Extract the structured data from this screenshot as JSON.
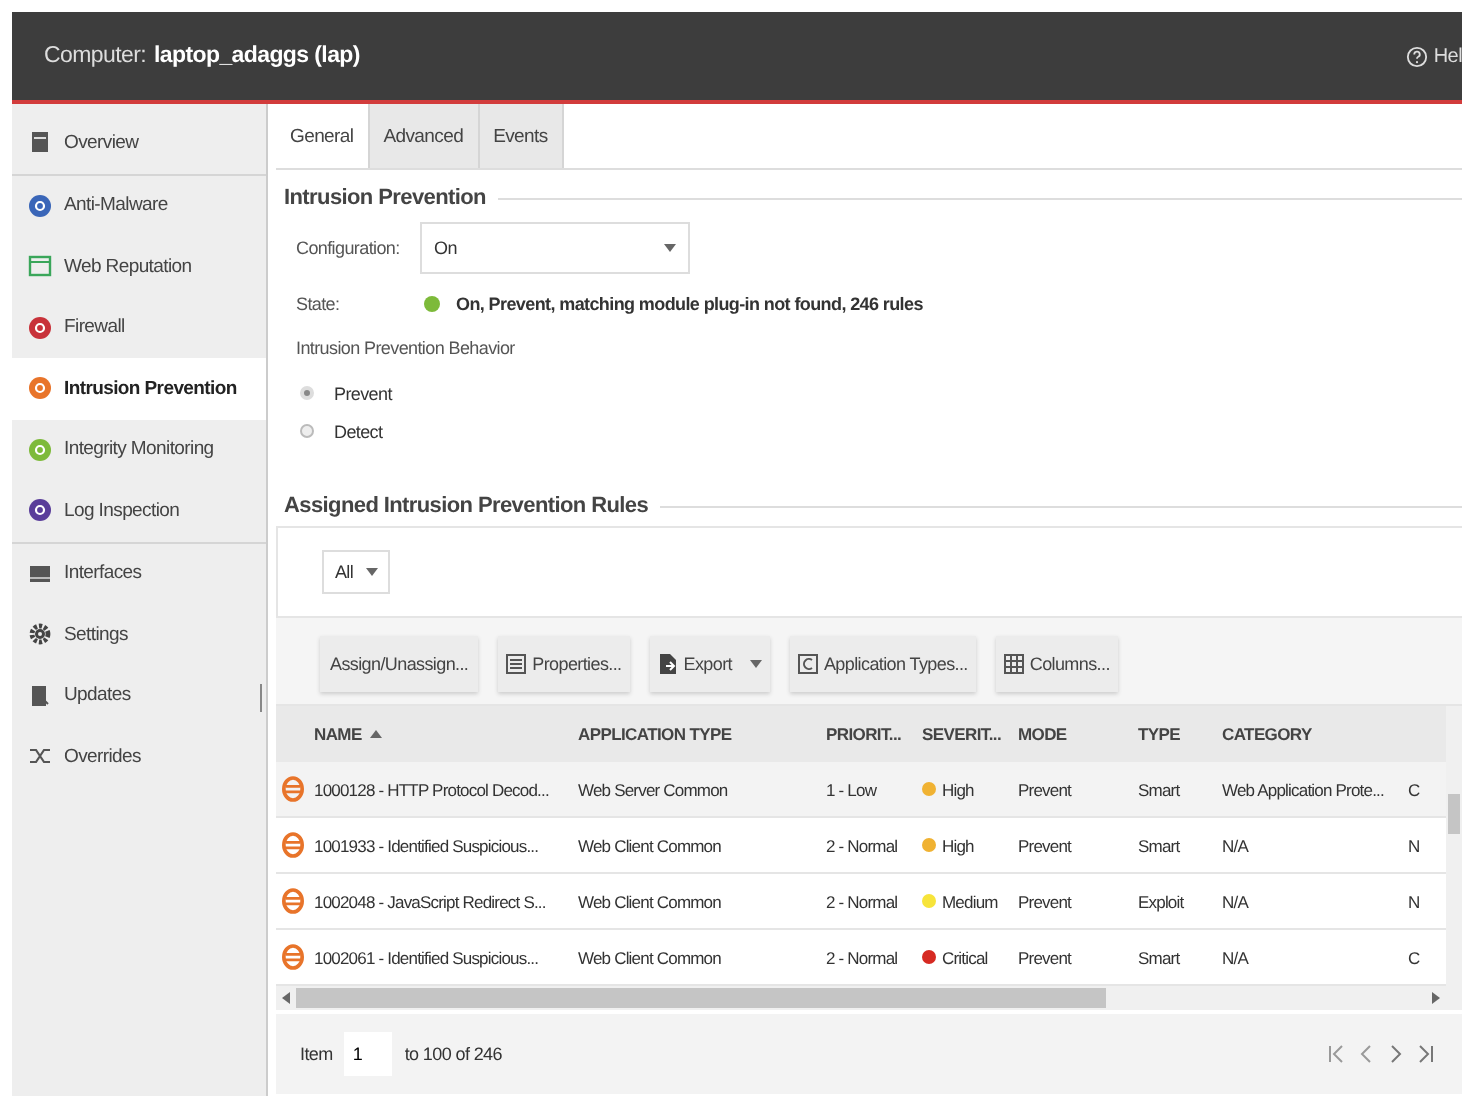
{
  "header": {
    "label": "Computer:",
    "computer": "laptop_adaggs (lap)",
    "help": "Hel"
  },
  "sidebar": {
    "groups": [
      [
        {
          "label": "Overview",
          "kind": "overview",
          "selected": false
        }
      ],
      [
        {
          "label": "Anti-Malware",
          "kind": "anti-malware",
          "selected": false
        },
        {
          "label": "Web Reputation",
          "kind": "web-reputation",
          "selected": false
        },
        {
          "label": "Firewall",
          "kind": "firewall",
          "selected": false
        },
        {
          "label": "Intrusion Prevention",
          "kind": "intrusion",
          "selected": true
        },
        {
          "label": "Integrity Monitoring",
          "kind": "integrity",
          "selected": false
        },
        {
          "label": "Log Inspection",
          "kind": "log",
          "selected": false
        }
      ],
      [
        {
          "label": "Interfaces",
          "kind": "interfaces",
          "selected": false
        },
        {
          "label": "Settings",
          "kind": "settings",
          "selected": false
        },
        {
          "label": "Updates",
          "kind": "updates",
          "selected": false
        },
        {
          "label": "Overrides",
          "kind": "overrides",
          "selected": false
        }
      ]
    ]
  },
  "tabs": [
    {
      "label": "General",
      "selected": true
    },
    {
      "label": "Advanced",
      "selected": false
    },
    {
      "label": "Events",
      "selected": false
    }
  ],
  "intrusion_prevention": {
    "title": "Intrusion Prevention",
    "configuration_label": "Configuration:",
    "configuration_value": "On",
    "state_label": "State:",
    "state": {
      "color": "#7dba3a"
    },
    "state_text": "On, Prevent, matching module plug-in not found, 246 rules",
    "behavior_label": "Intrusion Prevention Behavior",
    "behaviors": [
      {
        "label": "Prevent",
        "selected": true
      },
      {
        "label": "Detect",
        "selected": false
      }
    ]
  },
  "rules": {
    "title": "Assigned Intrusion Prevention Rules",
    "filter": "All",
    "toolbar": [
      {
        "label": "Assign/Unassign...",
        "kind": "plain"
      },
      {
        "label": "Properties...",
        "kind": "properties"
      },
      {
        "label": "Export",
        "kind": "export"
      },
      {
        "label": "Application Types...",
        "kind": "apptypes"
      },
      {
        "label": "Columns...",
        "kind": "columns"
      }
    ],
    "columns": [
      {
        "label": "NAME",
        "sorted": true
      },
      {
        "label": "APPLICATION TYPE",
        "sorted": false
      },
      {
        "label": "PRIORIT...",
        "sorted": false
      },
      {
        "label": "SEVERIT...",
        "sorted": false
      },
      {
        "label": "MODE",
        "sorted": false
      },
      {
        "label": "TYPE",
        "sorted": false
      },
      {
        "label": "CATEGORY",
        "sorted": false
      }
    ],
    "rows": [
      {
        "name": "1000128 - HTTP Protocol Decod...",
        "application_type": "Web Server Common",
        "priority": "1 - Low",
        "severity": "High",
        "color": "#f0b232",
        "mode": "Prevent",
        "type": "Smart",
        "category": "Web Application Prote...",
        "column_8": "C"
      },
      {
        "name": "1001933 - Identified Suspicious...",
        "application_type": "Web Client Common",
        "priority": "2 - Normal",
        "severity": "High",
        "color": "#f0b232",
        "mode": "Prevent",
        "type": "Smart",
        "category": "N/A",
        "column_8": "N"
      },
      {
        "name": "1002048 - JavaScript Redirect S...",
        "application_type": "Web Client Common",
        "priority": "2 - Normal",
        "severity": "Medium",
        "color": "#f7e43a",
        "mode": "Prevent",
        "type": "Exploit",
        "category": "N/A",
        "column_8": "N"
      },
      {
        "name": "1002061 - Identified Suspicious...",
        "application_type": "Web Client Common",
        "priority": "2 - Normal",
        "severity": "Critical",
        "color": "#d62a22",
        "mode": "Prevent",
        "type": "Smart",
        "category": "N/A",
        "column_8": "C"
      }
    ],
    "pagination": {
      "label": "Item",
      "page": "1",
      "range": "to 100 of 246"
    }
  }
}
